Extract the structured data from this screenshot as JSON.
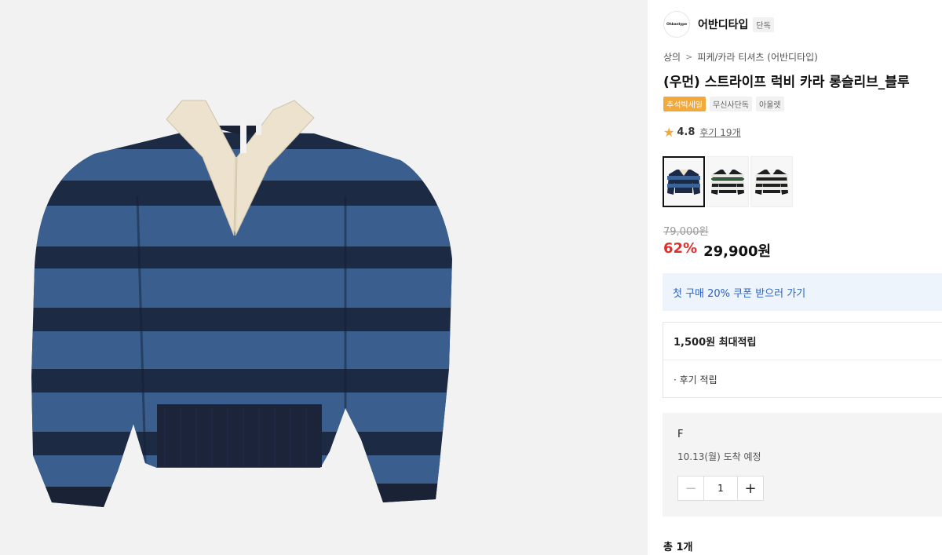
{
  "brand": {
    "logo_text": "Ohbantype",
    "name": "어반디타입",
    "badge": "단독"
  },
  "breadcrumb": {
    "category": "상의",
    "separator": ">",
    "subcategory": "피케/카라 티셔츠 (어반디타입)"
  },
  "product": {
    "title": "(우먼) 스트라이프 럭비 카라 롱슬리브_블루",
    "tags": [
      "추석빅세일",
      "무신사단독",
      "아울렛"
    ],
    "rating": "4.8",
    "review_link": "후기 19개",
    "swatches": [
      {
        "name": "navy-blue",
        "colors": [
          "#1c2a45",
          "#3c6395"
        ],
        "selected": true
      },
      {
        "name": "green-white",
        "colors": [
          "#1a1f22",
          "#e9e9e2",
          "#2f6b3a"
        ],
        "selected": false
      },
      {
        "name": "black-white",
        "colors": [
          "#1f1f22",
          "#e9e9e6"
        ],
        "selected": false
      }
    ],
    "original_price": "79,000원",
    "discount": "62%",
    "price": "29,900원"
  },
  "coupon": {
    "label": "첫 구매 20% 쿠폰 받으러 가기"
  },
  "points": {
    "header": "1,500원 최대적립",
    "item": "· 후기 적립"
  },
  "option": {
    "size": "F",
    "arrival": "10.13(월) 도착 예정",
    "minus": "−",
    "quantity": "1",
    "plus": "+"
  },
  "summary": {
    "total": "총 1개"
  },
  "colors": {
    "accent_orange": "#f2a93b",
    "discount_red": "#e0302c",
    "coupon_blue": "#2a64c8",
    "stripe_navy": "#1d2a44",
    "stripe_blue": "#3a5f8f",
    "collar_cream": "#ece2cd"
  }
}
